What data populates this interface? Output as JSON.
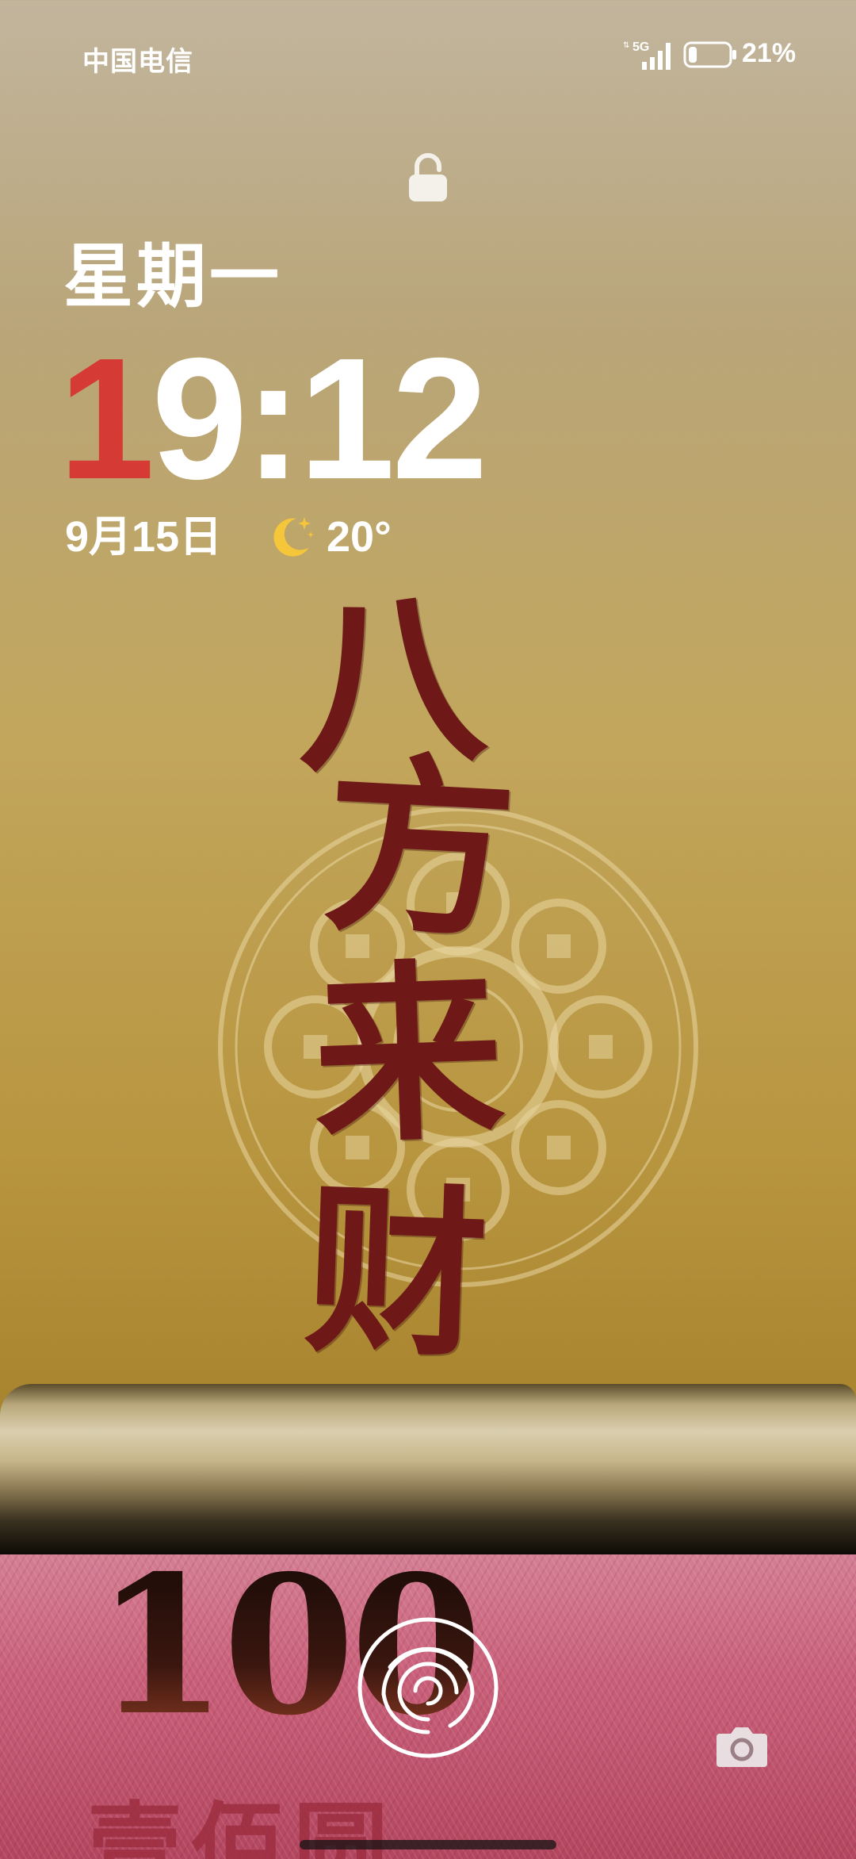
{
  "status_bar": {
    "carrier": "中国电信",
    "network_type": "5G",
    "battery_percent_label": "21%",
    "battery_level": 0.21
  },
  "lock_screen": {
    "lock_icon": "lock-icon",
    "weekday": "星期一",
    "time_first_digit": "1",
    "time_rest": "9:12",
    "date": "9月15日",
    "weather_icon": "moon-stars-icon",
    "temperature": "20°",
    "accent_color": "#d63a34"
  },
  "wallpaper": {
    "calligraphy": [
      "八",
      "方",
      "来",
      "财"
    ],
    "banknote_value": "100",
    "banknote_text": "壹佰圆",
    "calligraphy_color": "#6e1818"
  },
  "controls": {
    "fingerprint_icon": "fingerprint-icon",
    "camera_icon": "camera-icon"
  }
}
